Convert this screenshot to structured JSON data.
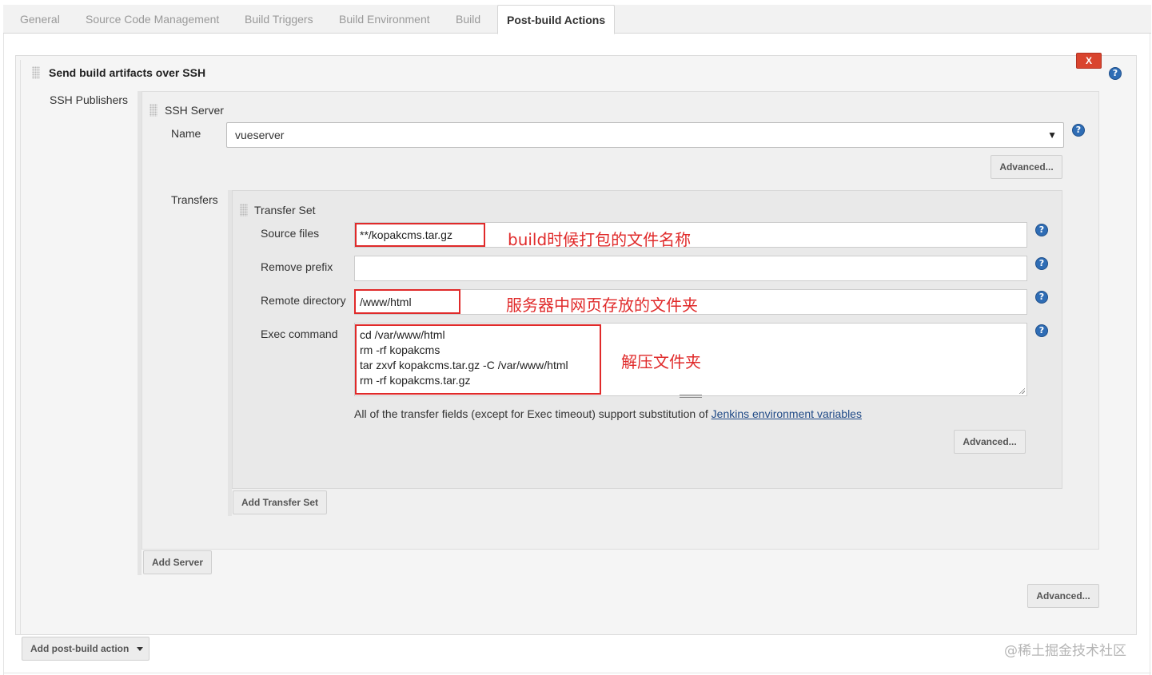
{
  "tabs": [
    {
      "label": "General",
      "active": false
    },
    {
      "label": "Source Code Management",
      "active": false
    },
    {
      "label": "Build Triggers",
      "active": false
    },
    {
      "label": "Build Environment",
      "active": false
    },
    {
      "label": "Build",
      "active": false
    },
    {
      "label": "Post-build Actions",
      "active": true
    }
  ],
  "section": {
    "title": "Send build artifacts over SSH",
    "delete_label": "X",
    "publishers_label": "SSH Publishers",
    "advanced_label": "Advanced...",
    "add_server_label": "Add Server"
  },
  "ssh_server": {
    "title": "SSH Server",
    "name_label": "Name",
    "name_value": "vueserver",
    "advanced_label": "Advanced..."
  },
  "transfers": {
    "label": "Transfers",
    "set_title": "Transfer Set",
    "source_files_label": "Source files",
    "source_files_value": "**/kopakcms.tar.gz",
    "remove_prefix_label": "Remove prefix",
    "remove_prefix_value": "",
    "remote_directory_label": "Remote directory",
    "remote_directory_value": "/www/html",
    "exec_command_label": "Exec command",
    "exec_command_lines": [
      "cd /var/www/html",
      "rm -rf kopakcms",
      "tar zxvf kopakcms.tar.gz -C /var/www/html",
      "rm -rf kopakcms.tar.gz"
    ],
    "note_text": "All of the transfer fields (except for Exec timeout) support substitution of ",
    "note_link": "Jenkins environment variables",
    "advanced_label": "Advanced...",
    "add_transfer_set_label": "Add Transfer Set"
  },
  "annotations": {
    "source_files": "build时候打包的文件名称",
    "remote_directory": "服务器中网页存放的文件夹",
    "exec_command": "解压文件夹"
  },
  "footer": {
    "add_post_build_label": "Add post-build action",
    "watermark": "@稀土掘金技术社区"
  },
  "help_icon_glyph": "?",
  "colors": {
    "annotation_red": "#e02a2a",
    "help_blue": "#2f6db5",
    "delete_red": "#d9442e"
  }
}
